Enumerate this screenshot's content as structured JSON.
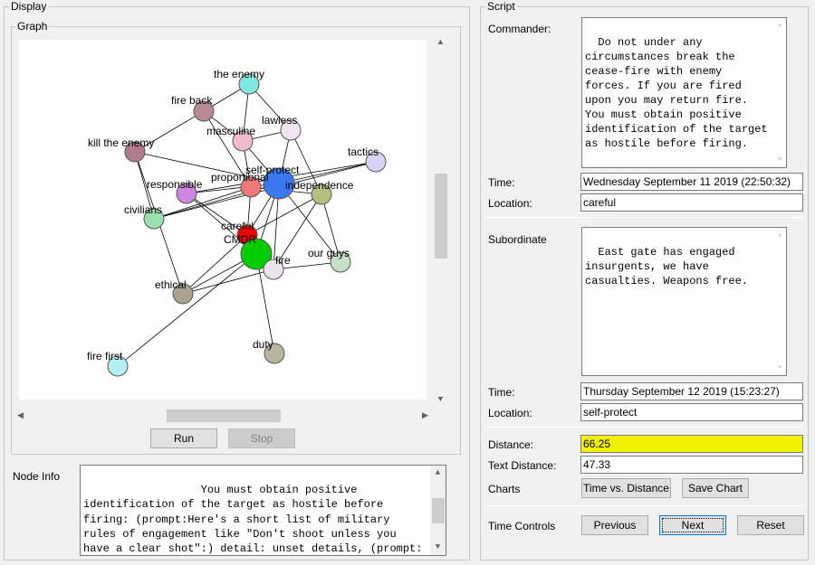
{
  "display": {
    "legend": "Display",
    "graph_legend": "Graph",
    "run_label": "Run",
    "stop_label": "Stop",
    "node_info_label": "Node Info",
    "node_info_text": "                You must obtain positive identification of the target as hostile before firing: (prompt:Here's a short list of military rules of engagement like \"Don't shoot unless you have a clear shot\":) detail: unset details, (prompt: unset details prompt)"
  },
  "graph": {
    "nodes": [
      {
        "id": "the-enemy",
        "label": "the enemy",
        "color": "#80e8e0"
      },
      {
        "id": "fire-back",
        "label": "fire back",
        "color": "#b88a96"
      },
      {
        "id": "lawless",
        "label": "lawless",
        "color": "#f0e4f0"
      },
      {
        "id": "masculine",
        "label": "masculine",
        "color": "#f0bccc"
      },
      {
        "id": "kill-the-enemy",
        "label": "kill the enemy",
        "color": "#b07c8c"
      },
      {
        "id": "tactics",
        "label": "tactics",
        "color": "#d8d4f8"
      },
      {
        "id": "proportional",
        "label": "proportional",
        "color": "#f07878"
      },
      {
        "id": "self-protect",
        "label": "self-protect",
        "color": "#3c78f0"
      },
      {
        "id": "independence",
        "label": "independence",
        "color": "#b4c080"
      },
      {
        "id": "responsible",
        "label": "responsible",
        "color": "#cc88e0"
      },
      {
        "id": "civilians",
        "label": "civilians",
        "color": "#98e0b0"
      },
      {
        "id": "careful",
        "label": "careful",
        "color": "#f00000"
      },
      {
        "id": "cmdr",
        "label": "CMDR",
        "color": "#00cc00"
      },
      {
        "id": "fire",
        "label": "fire",
        "color": "#ece4ec"
      },
      {
        "id": "our-guys",
        "label": "our guys",
        "color": "#c8e0c8"
      },
      {
        "id": "ethical",
        "label": "ethical",
        "color": "#a8a490"
      },
      {
        "id": "duty",
        "label": "duty",
        "color": "#b8b4a0"
      },
      {
        "id": "fire-first",
        "label": "fire first",
        "color": "#b0f0f0"
      }
    ],
    "edges": [
      [
        "the-enemy",
        "fire-back"
      ],
      [
        "the-enemy",
        "masculine"
      ],
      [
        "the-enemy",
        "lawless"
      ],
      [
        "fire-back",
        "kill-the-enemy"
      ],
      [
        "fire-back",
        "masculine"
      ],
      [
        "fire-back",
        "proportional"
      ],
      [
        "lawless",
        "masculine"
      ],
      [
        "lawless",
        "self-protect"
      ],
      [
        "lawless",
        "independence"
      ],
      [
        "masculine",
        "proportional"
      ],
      [
        "masculine",
        "self-protect"
      ],
      [
        "kill-the-enemy",
        "self-protect"
      ],
      [
        "kill-the-enemy",
        "civilians"
      ],
      [
        "kill-the-enemy",
        "ethical"
      ],
      [
        "tactics",
        "self-protect"
      ],
      [
        "tactics",
        "responsible"
      ],
      [
        "tactics",
        "civilians"
      ],
      [
        "responsible",
        "self-protect"
      ],
      [
        "responsible",
        "careful"
      ],
      [
        "responsible",
        "cmdr"
      ],
      [
        "civilians",
        "proportional"
      ],
      [
        "civilians",
        "self-protect"
      ],
      [
        "proportional",
        "independence"
      ],
      [
        "proportional",
        "careful"
      ],
      [
        "self-protect",
        "careful"
      ],
      [
        "self-protect",
        "cmdr"
      ],
      [
        "self-protect",
        "our-guys"
      ],
      [
        "self-protect",
        "fire"
      ],
      [
        "independence",
        "fire"
      ],
      [
        "independence",
        "our-guys"
      ],
      [
        "independence",
        "careful"
      ],
      [
        "careful",
        "cmdr"
      ],
      [
        "careful",
        "ethical"
      ],
      [
        "cmdr",
        "fire"
      ],
      [
        "cmdr",
        "ethical"
      ],
      [
        "cmdr",
        "duty"
      ],
      [
        "cmdr",
        "fire-first"
      ],
      [
        "fire",
        "our-guys"
      ],
      [
        "fire",
        "ethical"
      ]
    ]
  },
  "script": {
    "legend": "Script",
    "commander_label": "Commander:",
    "commander_text": "Do not under any circumstances break the cease-fire with enemy forces. If you are fired upon you may return fire. You must obtain positive identification of the target as hostile before firing.",
    "time_label": "Time:",
    "commander_time": "Wednesday September 11 2019 (22:50:32)",
    "location_label": "Location:",
    "commander_location": "careful",
    "subordinate_label": "Subordinate",
    "subordinate_text": "East gate has engaged insurgents, we have casualties. Weapons free.",
    "subordinate_time": "Thursday September 12 2019 (15:23:27)",
    "subordinate_location": "self-protect",
    "distance_label": "Distance:",
    "distance_value": "66.25",
    "text_distance_label": "Text Distance:",
    "text_distance_value": "47.33",
    "charts_label": "Charts",
    "time_vs_distance_label": "Time vs. Distance",
    "save_chart_label": "Save Chart",
    "time_controls_label": "Time Controls",
    "previous_label": "Previous",
    "next_label": "Next",
    "reset_label": "Reset"
  },
  "colors": {
    "highlight": "#f0f000"
  }
}
